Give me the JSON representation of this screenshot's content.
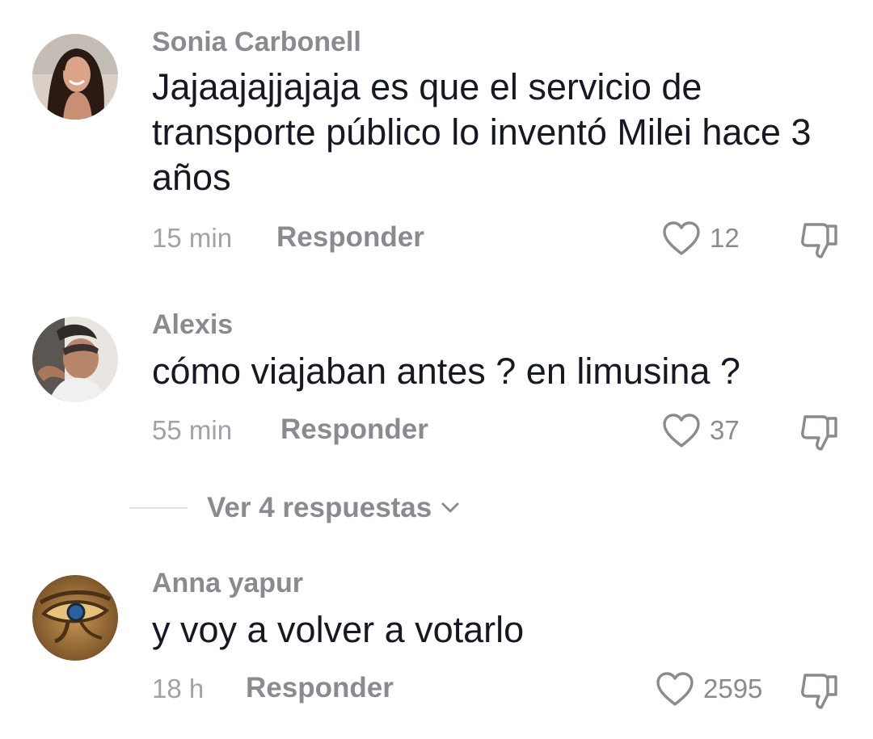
{
  "comments": [
    {
      "username": "Sonia Carbonell",
      "text": "Jajaajajjajaja es que el servicio de transporte público lo inventó Milei hace 3 años",
      "time": "15 min",
      "reply_label": "Responder",
      "likes": "12",
      "avatar": "woman-smiling-photo"
    },
    {
      "username": "Alexis",
      "text": "cómo viajaban antes ? en limusina ?",
      "time": "55 min",
      "reply_label": "Responder",
      "likes": "37",
      "avatar": "man-selfie-photo"
    },
    {
      "username": "Anna yapur",
      "text": "y voy a volver a votarlo",
      "time": "18 h",
      "reply_label": "Responder",
      "likes": "2595",
      "avatar": "eye-of-horus-image"
    }
  ],
  "view_replies": {
    "label": "Ver 4 respuestas"
  },
  "icons": {
    "like": "heart-outline-icon",
    "dislike": "thumbs-down-icon",
    "expand": "chevron-down-icon"
  },
  "colors": {
    "text": "#161823",
    "muted": "#8a8b91",
    "meta": "#a1a2a7"
  }
}
